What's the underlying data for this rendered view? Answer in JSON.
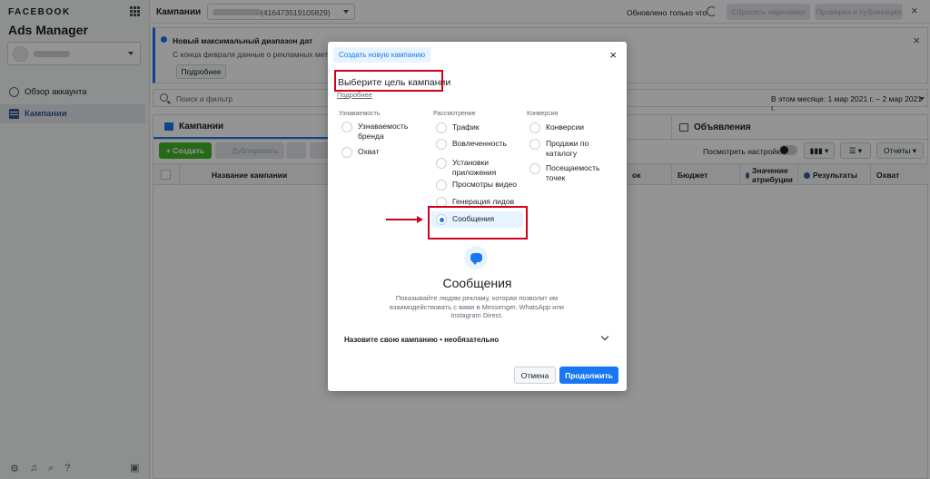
{
  "sidebar": {
    "brand": "FACEBOOK",
    "app_name": "Ads Manager",
    "items": [
      {
        "label": "Обзор аккаунта"
      },
      {
        "label": "Кампании"
      }
    ]
  },
  "topbar": {
    "title": "Кампании",
    "campaign_id": "(416473519105829)",
    "updated_text": "Обновлено только что",
    "discard_label": "Сбросить черновики",
    "publish_label": "Проверка и публикация"
  },
  "banner": {
    "title": "Новый максимальный диапазон дат",
    "text": "С конца февраля данные о рекламных метриках",
    "button_label": "Подробнее"
  },
  "search": {
    "placeholder": "Поиск и фильтр",
    "date_range": "В этом месяце: 1 мар 2021 г. – 2 мар 2021 г."
  },
  "panel": {
    "tab_campaigns": "Кампании",
    "tab_ads": "Объявления",
    "create_label": "Создать",
    "duplicate_label": "Дублировать",
    "view_settings": "Посмотреть настройки",
    "reports_label": "Отчеты",
    "columns": [
      "Название кампании",
      "ок",
      "Бюджет",
      "Значение атрибуции",
      "Результаты",
      "Охват"
    ]
  },
  "modal": {
    "chip": "Создать новую кампанию",
    "title": "Выберите цель кампании",
    "link": "Подробнее",
    "columns": [
      {
        "heading": "Узнаваемость",
        "options": [
          "Узнаваемость бренда",
          "Охват"
        ]
      },
      {
        "heading": "Рассмотрение",
        "options": [
          "Трафик",
          "Вовлеченность",
          "Установки приложения",
          "Просмотры видео",
          "Генерация лидов",
          "Сообщения"
        ]
      },
      {
        "heading": "Конверсия",
        "options": [
          "Конверсии",
          "Продажи по каталогу",
          "Посещаемость точек"
        ]
      }
    ],
    "selected": "Сообщения",
    "desc_title": "Сообщения",
    "desc_text": "Показывайте людям рекламу, которая позволит им взаимодействовать с вами в Messenger, WhatsApp или Instagram Direct.",
    "name_row": "Назовите свою кампанию • необязательно",
    "cancel_label": "Отмена",
    "continue_label": "Продолжить"
  },
  "colors": {
    "accent": "#1877f2",
    "create_green": "#42b72a",
    "annotation_red": "#d0021b"
  }
}
